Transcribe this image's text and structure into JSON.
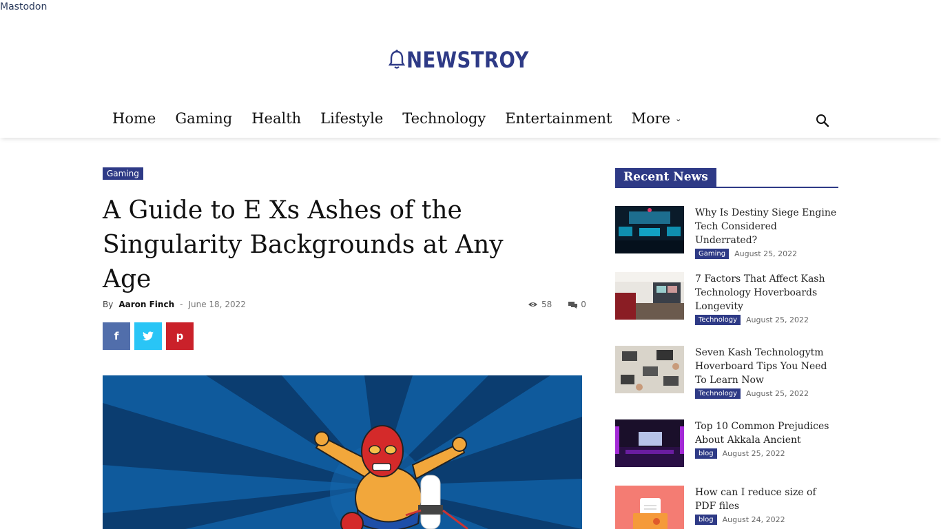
{
  "top_link": "Mastodon",
  "logo": {
    "text": "NEWSTROY"
  },
  "nav": {
    "items": [
      "Home",
      "Gaming",
      "Health",
      "Lifestyle",
      "Technology",
      "Entertainment",
      "More"
    ]
  },
  "article": {
    "category": "Gaming",
    "title": "A Guide to E Xs Ashes of the Singularity Backgrounds at Any Age",
    "by": "By",
    "author": "Aaron Finch",
    "separator": "-",
    "date": "June 18, 2022",
    "views": "58",
    "comments": "0"
  },
  "share": {
    "facebook": "f",
    "pinterest": "p"
  },
  "sidebar": {
    "heading": "Recent News",
    "items": [
      {
        "title": "Why Is Destiny Siege Engine Tech Considered Underrated?",
        "tag": "Gaming",
        "date": "August 25, 2022"
      },
      {
        "title": "7 Factors That Affect Kash Technology Hoverboards Longevity",
        "tag": "Technology",
        "date": "August 25, 2022"
      },
      {
        "title": "Seven Kash Technologytm Hoverboard Tips You Need To Learn Now",
        "tag": "Technology",
        "date": "August 25, 2022"
      },
      {
        "title": "Top 10 Common Prejudices About Akkala Ancient",
        "tag": "blog",
        "date": "August 25, 2022"
      },
      {
        "title": "How can I reduce size of PDF files",
        "tag": "blog",
        "date": "August 24, 2022"
      }
    ]
  },
  "colors": {
    "brand": "#2e3a86",
    "facebook": "#516eab",
    "twitter": "#29c5f6",
    "pinterest": "#ca212a"
  }
}
